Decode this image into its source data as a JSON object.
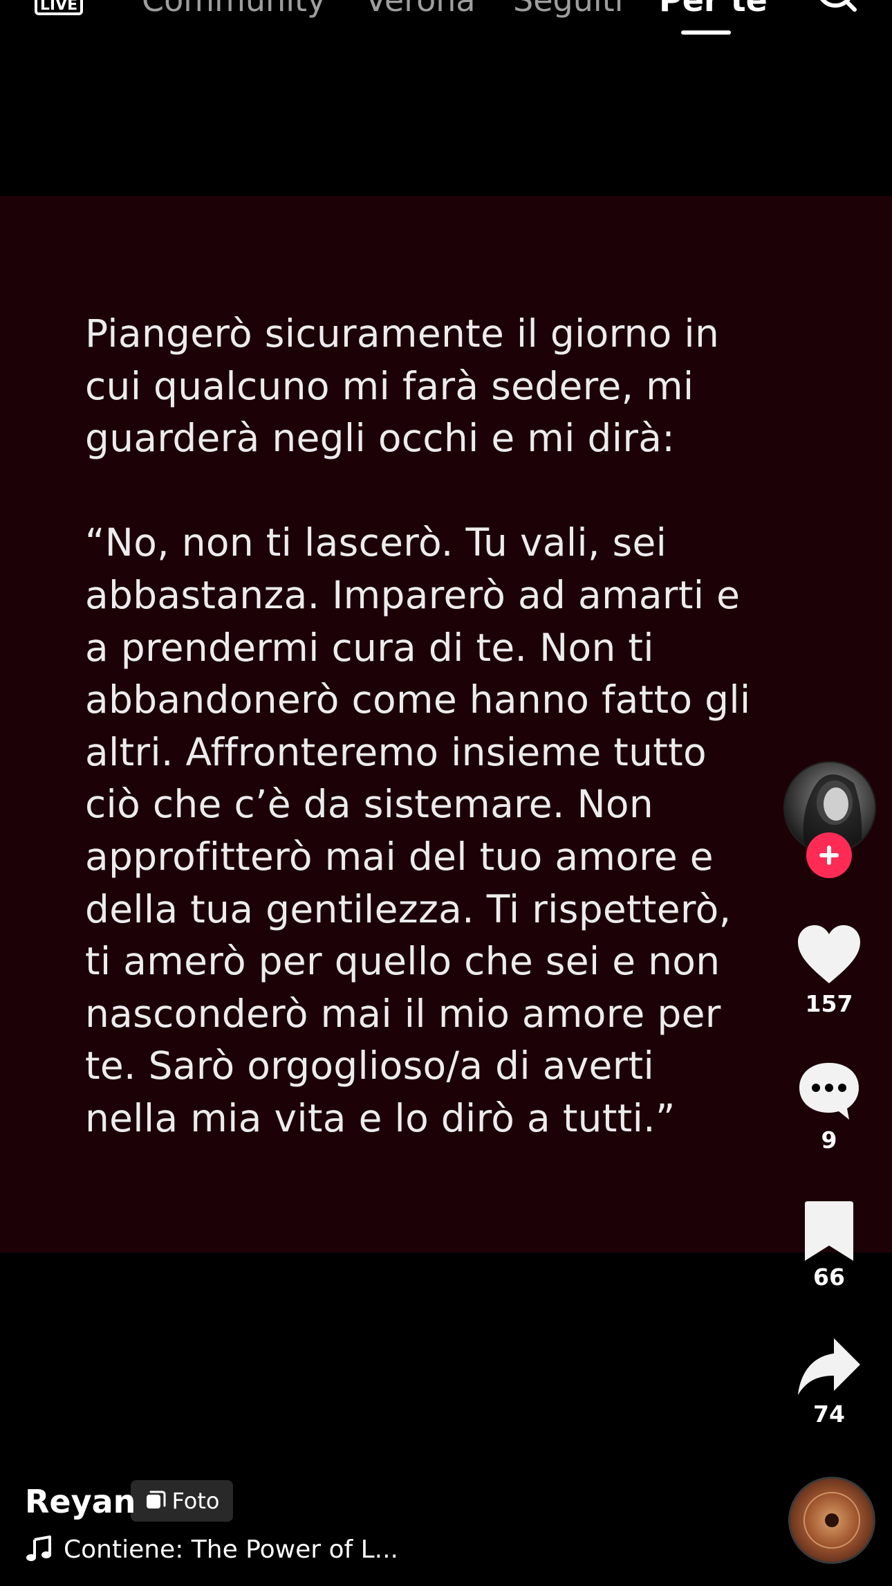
{
  "nav": {
    "live_icon": "live-icon",
    "tabs": [
      {
        "label": "Community",
        "active": false
      },
      {
        "label": "Verona",
        "active": false
      },
      {
        "label": "Seguiti",
        "active": false
      },
      {
        "label": "Per te",
        "active": true
      }
    ],
    "search_icon": "search-icon"
  },
  "post": {
    "quote_text": "Piangerò sicuramente il giorno in\ncui qualcuno mi farà sedere, mi\nguarderà negli occhi e mi dirà:\n\n“No, non ti lascerò. Tu vali, sei\nabbastanza. Imparerò ad amarti e\na prendermi cura di te. Non ti\nabbandonerò come hanno fatto gli\naltri. Affronteremo insieme tutto\nciò che c’è da sistemare. Non\napprofitterò mai del tuo amore e\ndella tua gentilezza. Ti rispetterò,\nti amerò per quello che sei e non\nnasconderò mai il mio amore per\nte. Sarò orgoglioso/a di averti\nnella mia vita e lo dirò a tutti.”",
    "background_color": "#1c0207"
  },
  "actions": {
    "likes": "157",
    "comments": "9",
    "saves": "66",
    "shares": "74",
    "follow_accent": "#fe2c55"
  },
  "author": {
    "username": "Reyan",
    "badge_label": "Foto"
  },
  "music": {
    "text": "Contiene: The Power of L..."
  }
}
